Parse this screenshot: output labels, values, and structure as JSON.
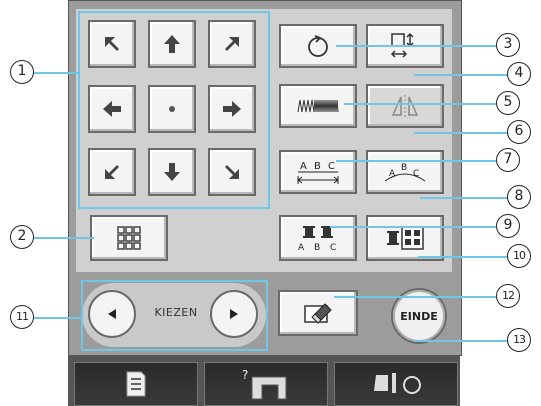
{
  "kiezen": {
    "label": "KIEZEN"
  },
  "einde": {
    "label": "EINDE"
  },
  "callouts": {
    "c1": "1",
    "c2": "2",
    "c3": "3",
    "c4": "4",
    "c5": "5",
    "c6": "6",
    "c7": "7",
    "c8": "8",
    "c9": "9",
    "c10": "10",
    "c11": "11",
    "c12": "12",
    "c13": "13"
  },
  "buttons": {
    "rotate": "rotate-icon",
    "size": "size-icon",
    "density": "stitch-density-icon",
    "mirror": "mirror-icon",
    "spacing": "letter-spacing-icon",
    "arc": "arc-text-icon",
    "thread_letters": "thread-color-letters-icon",
    "thread_grid": "thread-color-grid-icon",
    "grid": "grid-icon",
    "eraser": "eraser-icon"
  },
  "bottom": {
    "b1": "list-icon",
    "b2": "help-machine-icon",
    "b3": "presser-foot-icon"
  },
  "colors": {
    "highlight": "#6ec6e8",
    "panel": "#d0d0d0",
    "frame": "#9c9c9c"
  }
}
